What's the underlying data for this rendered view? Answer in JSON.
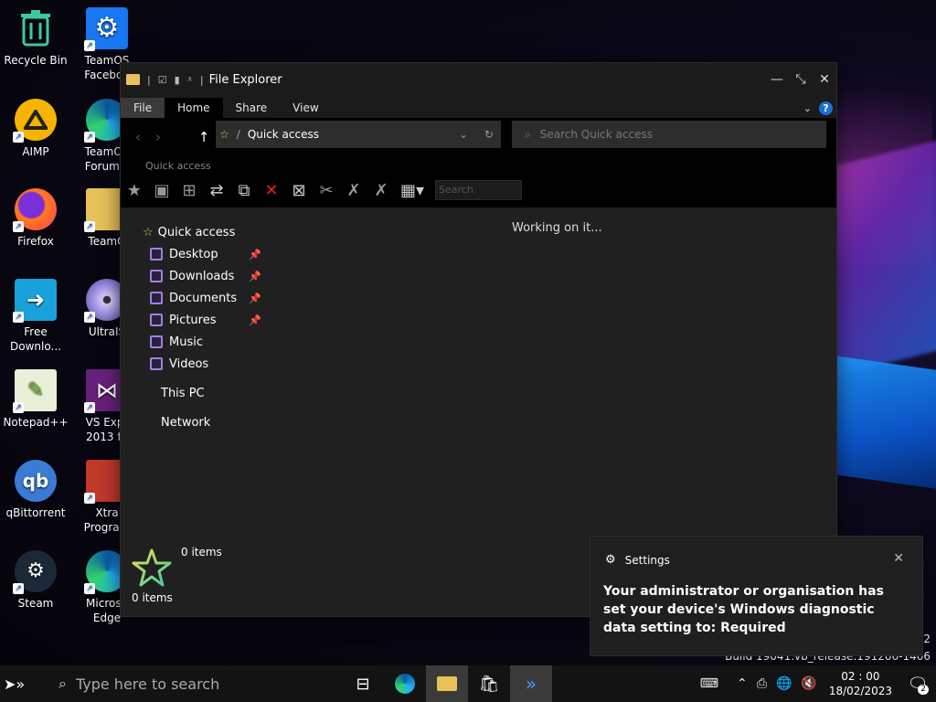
{
  "desktop": {
    "icons": [
      {
        "label": "Recycle Bin"
      },
      {
        "label": "TeamOS Faceboo"
      },
      {
        "label": "AIMP"
      },
      {
        "label": "TeamOS Forum L"
      },
      {
        "label": "Firefox"
      },
      {
        "label": "TeamO"
      },
      {
        "label": "Free Downlo..."
      },
      {
        "label": "UltraIS"
      },
      {
        "label": "Notepad++"
      },
      {
        "label": "VS Expr 2013 fo"
      },
      {
        "label": "qBittorrent"
      },
      {
        "label": "Xtra Program"
      },
      {
        "label": "Steam"
      },
      {
        "label": "Microso Edge"
      }
    ],
    "watermark": {
      "line1": "22",
      "line2": "Build 19041.vb_release.191206-1406"
    }
  },
  "explorer": {
    "title": "File Explorer",
    "tabs": [
      "File",
      "Home",
      "Share",
      "View"
    ],
    "active_tab": "Home",
    "address": "Quick access",
    "search_placeholder": "Search Quick access",
    "ribbon_group": "Quick access",
    "ribbon_search": "Search",
    "nav": {
      "quick_access": "Quick access",
      "items": [
        {
          "label": "Desktop",
          "pinned": true
        },
        {
          "label": "Downloads",
          "pinned": true
        },
        {
          "label": "Documents",
          "pinned": true
        },
        {
          "label": "Pictures",
          "pinned": true
        },
        {
          "label": "Music",
          "pinned": false
        },
        {
          "label": "Videos",
          "pinned": false
        }
      ],
      "this_pc": "This PC",
      "network": "Network"
    },
    "content_status": "Working on it...",
    "status_big": "0 items",
    "status_small": "0 items"
  },
  "toast": {
    "app": "Settings",
    "message": "Your administrator or organisation has set your device's Windows diagnostic data setting to: Required"
  },
  "taskbar": {
    "search_placeholder": "Type here to search",
    "time": "02 : 00",
    "date": "18/02/2023",
    "notification_count": "2"
  }
}
